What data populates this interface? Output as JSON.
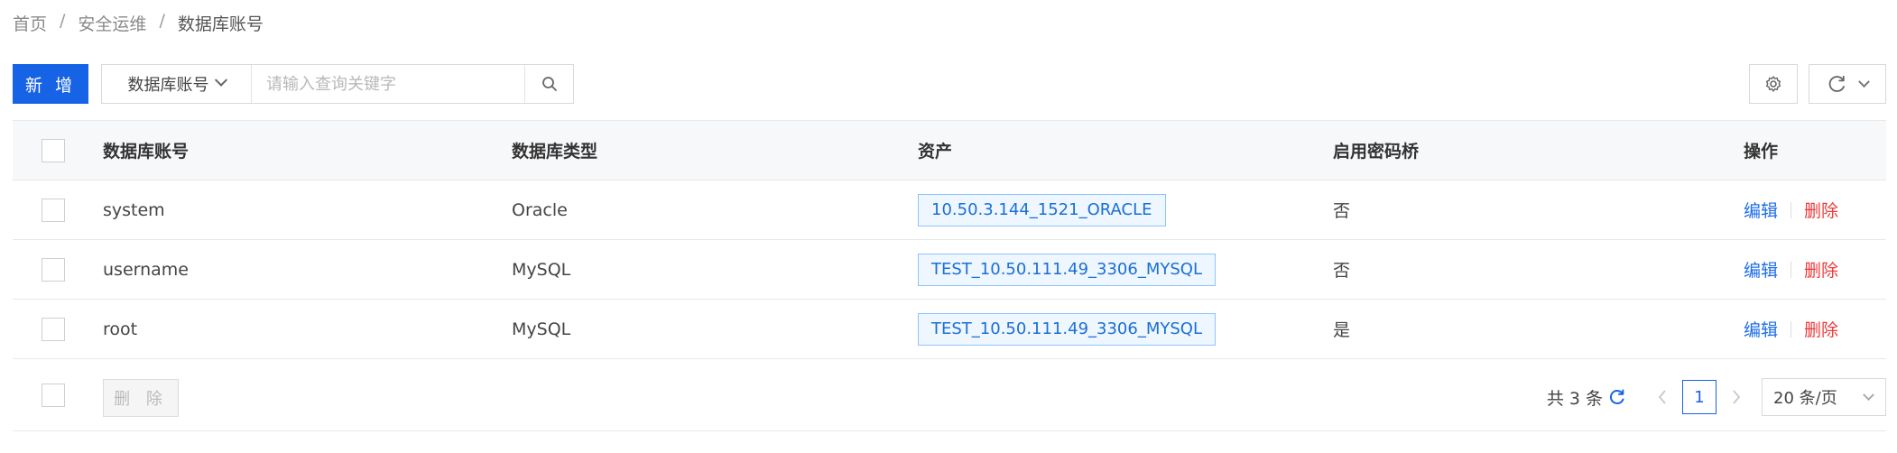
{
  "breadcrumb": {
    "items": [
      "首页",
      "安全运维",
      "数据库账号"
    ],
    "separator": "/"
  },
  "toolbar": {
    "add_label": "新 增",
    "search_field": "数据库账号",
    "search_placeholder": "请输入查询关键字",
    "search_icon": "search-icon",
    "settings_icon": "gear-icon",
    "refresh_icon": "refresh-icon"
  },
  "table": {
    "columns": [
      "数据库账号",
      "数据库类型",
      "资产",
      "启用密码桥",
      "操作"
    ],
    "rows": [
      {
        "account": "system",
        "db_type": "Oracle",
        "asset": "10.50.3.144_1521_ORACLE",
        "pwd_bridge": "否",
        "edit": "编辑",
        "delete": "删除"
      },
      {
        "account": "username",
        "db_type": "MySQL",
        "asset": "TEST_10.50.111.49_3306_MYSQL",
        "pwd_bridge": "否",
        "edit": "编辑",
        "delete": "删除"
      },
      {
        "account": "root",
        "db_type": "MySQL",
        "asset": "TEST_10.50.111.49_3306_MYSQL",
        "pwd_bridge": "是",
        "edit": "编辑",
        "delete": "删除"
      }
    ]
  },
  "footer": {
    "bulk_delete_label": "删 除",
    "total_text": "共 3 条",
    "current_page": "1",
    "page_size": "20 条/页"
  },
  "colors": {
    "primary": "#1763e6",
    "link": "#1d6ee8",
    "danger": "#ec3a3a",
    "tag_border": "#8cc4ff",
    "tag_bg": "#eef6ff"
  }
}
